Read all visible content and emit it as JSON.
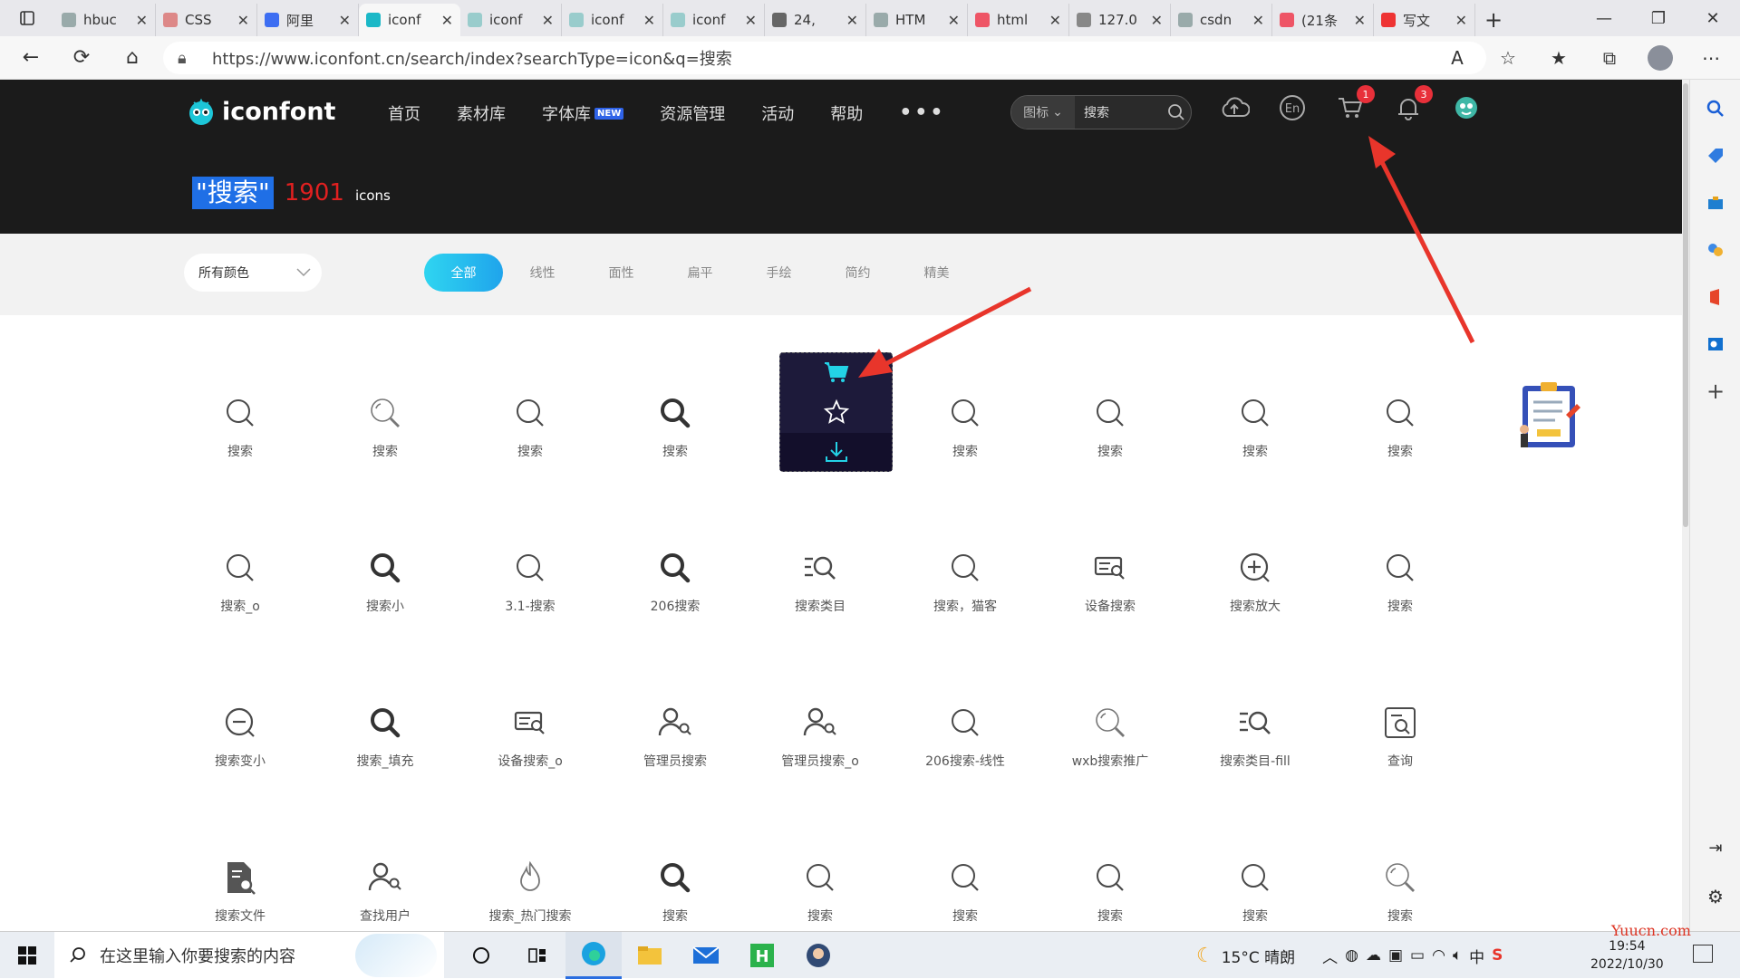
{
  "browser": {
    "tabs": [
      {
        "title": "hbuc",
        "color": "#9aa"
      },
      {
        "title": "CSS",
        "color": "#d88"
      },
      {
        "title": "阿里",
        "color": "#3d6ef2"
      },
      {
        "title": "iconf",
        "color": "#1bb8c7",
        "active": true
      },
      {
        "title": "iconf",
        "color": "#9cc"
      },
      {
        "title": "iconf",
        "color": "#9cc"
      },
      {
        "title": "iconf",
        "color": "#9cc"
      },
      {
        "title": "24,",
        "color": "#666"
      },
      {
        "title": "HTM",
        "color": "#9aa"
      },
      {
        "title": "html",
        "color": "#e56"
      },
      {
        "title": "127.0",
        "color": "#888"
      },
      {
        "title": "csdn",
        "color": "#9aa"
      },
      {
        "title": "(21条",
        "color": "#e56"
      },
      {
        "title": "写文",
        "color": "#e33"
      }
    ],
    "url": "https://www.iconfont.cn/search/index?searchType=icon&q=搜索"
  },
  "site": {
    "logo_text": "iconfont",
    "menu": [
      "首页",
      "素材库",
      "字体库",
      "资源管理",
      "活动",
      "帮助"
    ],
    "new_badge": "NEW",
    "more": "•••",
    "search_type": "图标",
    "search_value": "搜索",
    "cart_badge": "1",
    "bell_badge": "3",
    "result_query": "\"搜索\"",
    "result_count": "1901",
    "result_unit": "icons"
  },
  "filters": {
    "color_select": "所有颜色",
    "styles": [
      "全部",
      "线性",
      "面性",
      "扁平",
      "手绘",
      "简约",
      "精美"
    ],
    "active_style": "全部"
  },
  "icons": [
    {
      "label": "搜索",
      "kind": "search-thin"
    },
    {
      "label": "搜索",
      "kind": "search-dot"
    },
    {
      "label": "搜索",
      "kind": "search-thin"
    },
    {
      "label": "搜索",
      "kind": "search-bold"
    },
    {
      "label": "",
      "kind": "hover"
    },
    {
      "label": "搜索",
      "kind": "search-thin"
    },
    {
      "label": "搜索",
      "kind": "search-thin"
    },
    {
      "label": "搜索",
      "kind": "search-thin"
    },
    {
      "label": "搜索",
      "kind": "search-thin"
    },
    {
      "label": "",
      "kind": "illustration"
    },
    {
      "label": "搜索_o",
      "kind": "search-thin"
    },
    {
      "label": "搜索小",
      "kind": "search-bold"
    },
    {
      "label": "3.1-搜索",
      "kind": "search-thin"
    },
    {
      "label": "206搜索",
      "kind": "search-bold"
    },
    {
      "label": "搜索类目",
      "kind": "list-search"
    },
    {
      "label": "搜索，猫客",
      "kind": "search-thin"
    },
    {
      "label": "设备搜索",
      "kind": "device-search"
    },
    {
      "label": "搜索放大",
      "kind": "zoom-in"
    },
    {
      "label": "搜索",
      "kind": "search-thin"
    },
    {
      "label": "搜索变小",
      "kind": "zoom-out"
    },
    {
      "label": "搜索_填充",
      "kind": "search-bold"
    },
    {
      "label": "设备搜索_o",
      "kind": "device-search"
    },
    {
      "label": "管理员搜索",
      "kind": "user-search"
    },
    {
      "label": "管理员搜索_o",
      "kind": "user-search"
    },
    {
      "label": "206搜索-线性",
      "kind": "search-thin"
    },
    {
      "label": "wxb搜索推广",
      "kind": "search-dot"
    },
    {
      "label": "搜索类目-fill",
      "kind": "list-search"
    },
    {
      "label": "查询",
      "kind": "frame-search"
    },
    {
      "label": "搜索文件",
      "kind": "file-search"
    },
    {
      "label": "查找用户",
      "kind": "user-search"
    },
    {
      "label": "搜索_热门搜索",
      "kind": "flame"
    },
    {
      "label": "搜索",
      "kind": "search-bold"
    },
    {
      "label": "搜索",
      "kind": "search-thin"
    },
    {
      "label": "搜索",
      "kind": "search-thin"
    },
    {
      "label": "搜索",
      "kind": "search-thin"
    },
    {
      "label": "搜索",
      "kind": "search-thin"
    },
    {
      "label": "搜索",
      "kind": "search-dot"
    }
  ],
  "taskbar": {
    "search_placeholder": "在这里输入你要搜索的内容",
    "weather": "15°C 晴朗",
    "ime": "中",
    "time": "19:54",
    "date": "2022/10/30"
  },
  "watermark": "Yuucn.com"
}
